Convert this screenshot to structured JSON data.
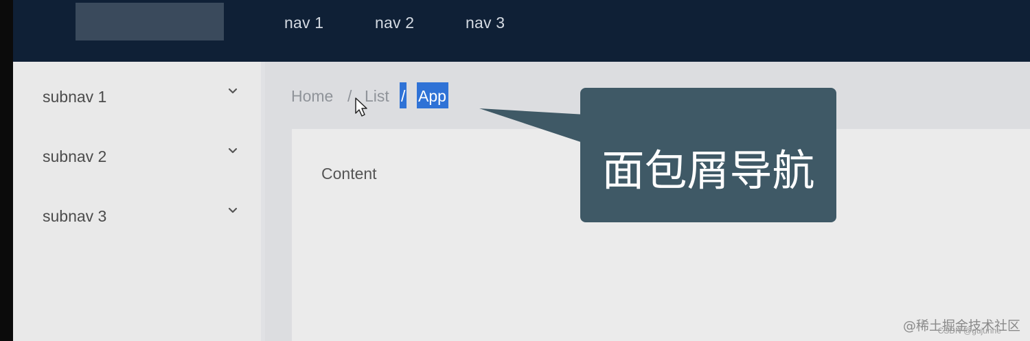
{
  "header": {
    "nav": [
      {
        "label": "nav 1"
      },
      {
        "label": "nav 2"
      },
      {
        "label": "nav 3"
      }
    ]
  },
  "sidebar": {
    "items": [
      {
        "label": "subnav 1",
        "icon": "chevron-down-icon"
      },
      {
        "label": "subnav 2",
        "icon": "chevron-down-icon"
      },
      {
        "label": "subnav 3",
        "icon": "chevron-down-icon"
      }
    ]
  },
  "breadcrumb": {
    "items": [
      "Home",
      "List",
      "App"
    ],
    "separator": "/"
  },
  "content": {
    "text": "Content"
  },
  "callout": {
    "text": "面包屑导航"
  },
  "watermark": {
    "text": "@稀土掘金技术社区",
    "sub": "CSDN @gujunhe"
  },
  "colors": {
    "header_bg": "#0f2036",
    "sidebar_bg": "#e9e9e9",
    "selection": "#2f72d6",
    "callout_bg": "#3f5966"
  }
}
